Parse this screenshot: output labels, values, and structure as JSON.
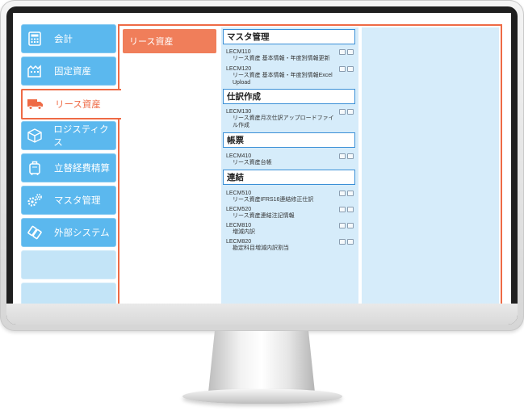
{
  "sidebar": {
    "items": [
      {
        "label": "会計",
        "icon": "calculator-icon"
      },
      {
        "label": "固定資産",
        "icon": "building-icon"
      },
      {
        "label": "リース資産",
        "icon": "truck-icon",
        "active": true
      },
      {
        "label": "ロジスティクス",
        "icon": "box-icon"
      },
      {
        "label": "立替経費精算",
        "icon": "suitcase-icon"
      },
      {
        "label": "マスタ管理",
        "icon": "gears-icon"
      },
      {
        "label": "外部システム",
        "icon": "link-icon"
      }
    ]
  },
  "subnav": {
    "selected": "リース資産"
  },
  "sections": [
    {
      "title": "マスタ管理",
      "entries": [
        {
          "code": "LECM110",
          "desc": "リース資産 基本情報・年度別情報更新"
        },
        {
          "code": "LECM120",
          "desc": "リース資産 基本情報・年度別情報Excel Upload"
        }
      ]
    },
    {
      "title": "仕訳作成",
      "entries": [
        {
          "code": "LECM130",
          "desc": "リース資産月次仕訳アップロードファイル作成"
        }
      ]
    },
    {
      "title": "帳票",
      "entries": [
        {
          "code": "LECM410",
          "desc": "リース資産台帳"
        }
      ]
    },
    {
      "title": "連結",
      "entries": [
        {
          "code": "LECM510",
          "desc": "リース資産IFRS16連結修正仕訳"
        },
        {
          "code": "LECM520",
          "desc": "リース資産連結注記情報"
        },
        {
          "code": "LECM810",
          "desc": "増減内訳"
        },
        {
          "code": "LECM820",
          "desc": "勘定科目増減内訳割当"
        }
      ]
    }
  ],
  "colors": {
    "accent": "#ee6a45",
    "sidebar_blue": "#5bb8ee",
    "panel_blue": "#d6ecfa",
    "header_border": "#3a8fd6"
  }
}
